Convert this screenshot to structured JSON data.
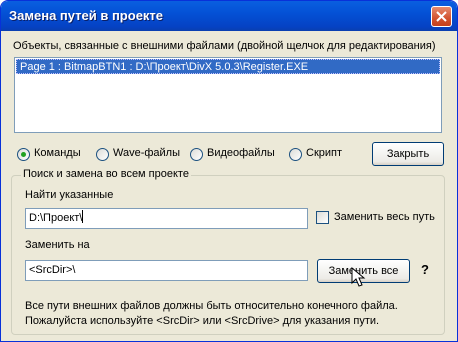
{
  "window": {
    "title": "Замена путей в проекте"
  },
  "objects": {
    "label": "Объекты, связанные с внешними файлами (двойной щелчок для редактирования)",
    "items": [
      "Page 1 : BitmapBTN1 : D:\\Проект\\DivX 5.0.3\\Register.EXE"
    ]
  },
  "radios": [
    {
      "label": "Команды",
      "checked": true
    },
    {
      "label": "Wave-файлы",
      "checked": false
    },
    {
      "label": "Видеофайлы",
      "checked": false
    },
    {
      "label": "Скрипт",
      "checked": false
    }
  ],
  "close_button": "Закрыть",
  "search": {
    "group_title": "Поиск и замена во всем проекте",
    "find_label": "Найти указанные",
    "find_value": "D:\\Проект\\",
    "replace_whole_label": "Заменить весь путь",
    "replace_label": "Заменить на",
    "replace_value": "<SrcDir>\\",
    "replace_all_button": "Заменить все",
    "help_icon": "?",
    "note_line1": "Все пути внешних файлов должны быть относительно конечного файла.",
    "note_line2": "Пожалуйста используйте <SrcDir> или <SrcDrive> для указания пути."
  }
}
